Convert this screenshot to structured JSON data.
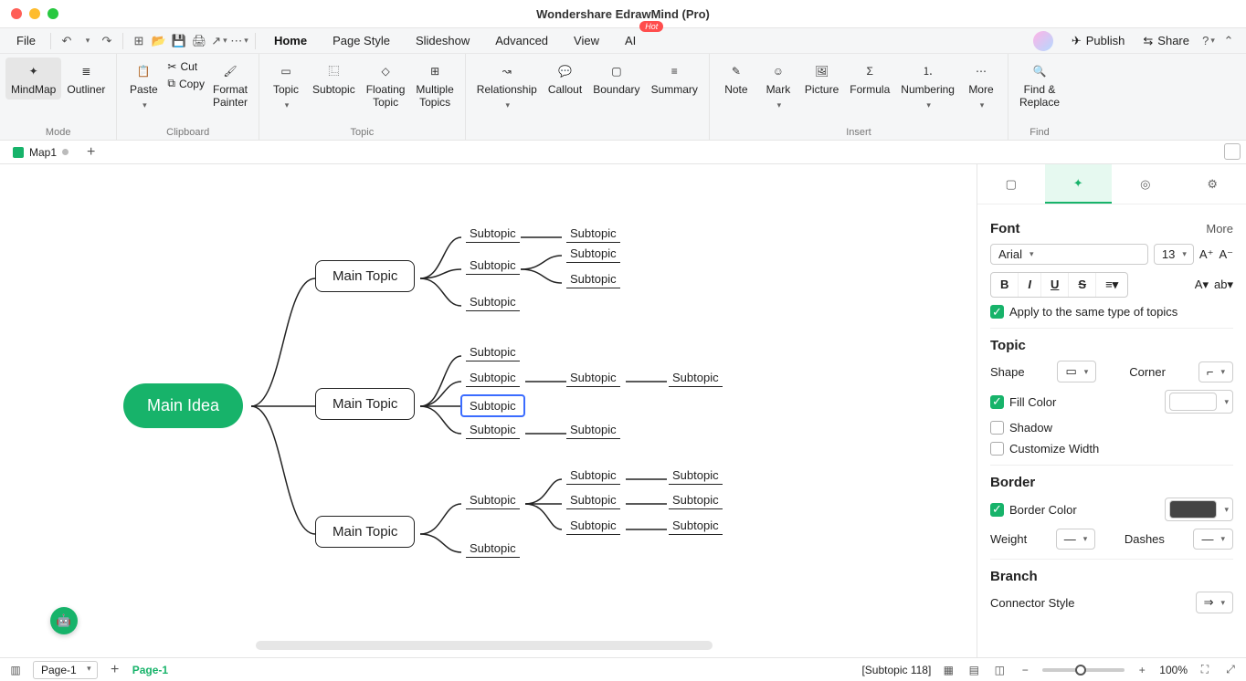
{
  "title": "Wondershare EdrawMind (Pro)",
  "menubar": {
    "file": "File",
    "tabs": [
      "Home",
      "Page Style",
      "Slideshow",
      "Advanced",
      "View",
      "AI"
    ],
    "active_tab": 0,
    "ai_badge": "Hot",
    "publish": "Publish",
    "share": "Share"
  },
  "ribbon": {
    "mode": {
      "mindmap": "MindMap",
      "outliner": "Outliner",
      "label": "Mode"
    },
    "clipboard": {
      "paste": "Paste",
      "cut": "Cut",
      "copy": "Copy",
      "format_painter": "Format\nPainter",
      "label": "Clipboard"
    },
    "topic": {
      "topic": "Topic",
      "subtopic": "Subtopic",
      "floating": "Floating\nTopic",
      "multiple": "Multiple\nTopics",
      "label": "Topic"
    },
    "relations": {
      "relationship": "Relationship",
      "callout": "Callout",
      "boundary": "Boundary",
      "summary": "Summary"
    },
    "insert": {
      "note": "Note",
      "mark": "Mark",
      "picture": "Picture",
      "formula": "Formula",
      "numbering": "Numbering",
      "more": "More",
      "label": "Insert"
    },
    "find": {
      "find_replace": "Find &\nReplace",
      "label": "Find"
    }
  },
  "doc_tab": "Map1",
  "canvas": {
    "root": "Main Idea",
    "main_topic": "Main Topic",
    "subtopic": "Subtopic"
  },
  "sidepanel": {
    "font_h": "Font",
    "more": "More",
    "font_family": "Arial",
    "font_size": "13",
    "apply_same": "Apply to the same type of topics",
    "topic_h": "Topic",
    "shape": "Shape",
    "corner": "Corner",
    "fill_color": "Fill Color",
    "shadow": "Shadow",
    "cust_width": "Customize Width",
    "border_h": "Border",
    "border_color": "Border Color",
    "weight": "Weight",
    "dashes": "Dashes",
    "branch_h": "Branch",
    "connector_style": "Connector Style"
  },
  "status": {
    "page_picker": "Page-1",
    "page_name": "Page-1",
    "selection": "[Subtopic 118]",
    "zoom": "100%"
  }
}
